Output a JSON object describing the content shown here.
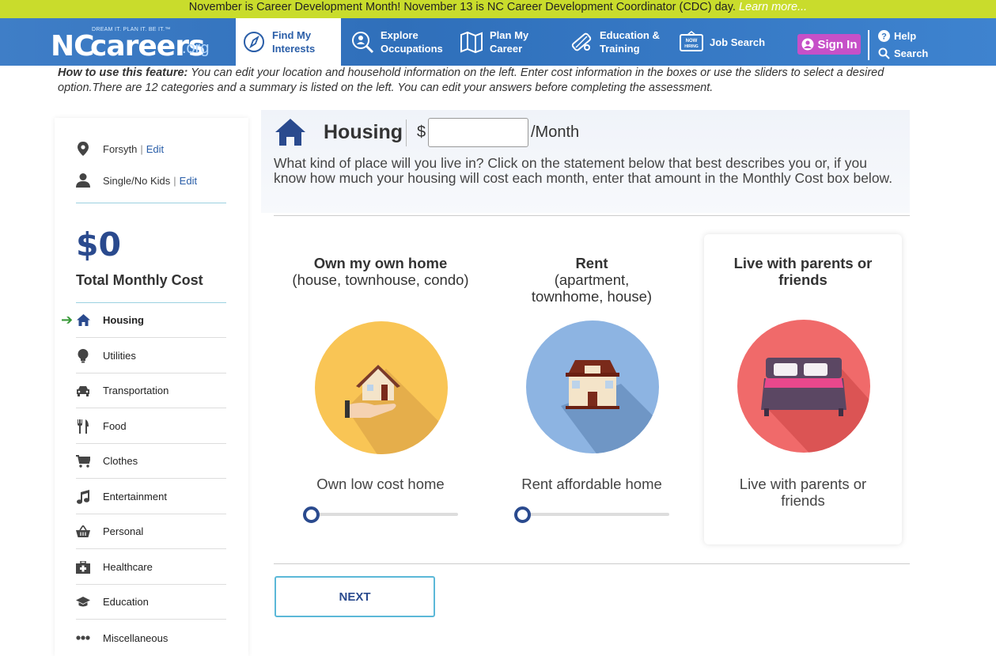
{
  "announcement": {
    "text": "November is Career Development Month! November 13 is NC Career Development Coordinator (CDC) day.",
    "link": "Learn more..."
  },
  "logo": {
    "nc": "NC",
    "careers": "careers",
    "org": ".org",
    "tagline": "DREAM IT. PLAN IT. BE IT.™"
  },
  "nav": {
    "items": [
      {
        "line1": "Find My",
        "line2": "Interests"
      },
      {
        "line1": "Explore",
        "line2": "Occupations"
      },
      {
        "line1": "Plan My",
        "line2": "Career"
      },
      {
        "line1": "Education &",
        "line2": "Training"
      },
      {
        "line1": "Job Search",
        "badge": "NOW HIRING"
      }
    ],
    "signin": "Sign In",
    "help": "Help",
    "search": "Search"
  },
  "howto": {
    "label": "How to use this feature:",
    "text": "You can edit your location and household information on the left. Enter cost information in the boxes or use the sliders to select a desired option.There are 12 categories and a summary is listed on the left. You can edit your answers before completing the assessment."
  },
  "sidebar": {
    "location": "Forsyth",
    "household": "Single/No Kids",
    "edit": "Edit",
    "total": "$0",
    "total_label": "Total Monthly Cost",
    "categories": [
      "Housing",
      "Utilities",
      "Transportation",
      "Food",
      "Clothes",
      "Entertainment",
      "Personal",
      "Healthcare",
      "Education",
      "Miscellaneous"
    ]
  },
  "main": {
    "title": "Housing",
    "dollar": "$",
    "cost_value": "",
    "per_month": "/Month",
    "question": "What kind of place will you live in? Click on the statement below that best describes you or, if you know how much your housing will cost each month, enter that amount in the Monthly Cost box below.",
    "options": [
      {
        "title": "Own my own home",
        "detail": "(house, townhouse, condo)",
        "sub": "Own low cost home",
        "slider_value": 0
      },
      {
        "title": "Rent",
        "detail": "(apartment, townhome, house)",
        "sub": "Rent affordable home",
        "slider_value": 0
      },
      {
        "title": "Live with parents or friends",
        "detail": "",
        "sub": "Live with parents or friends",
        "selected": true
      }
    ],
    "next": "NEXT"
  },
  "colors": {
    "announce_bg": "#c9dc2c",
    "nav_blue": "#3577c0",
    "signin_bg": "#c650c8",
    "accent_navy": "#2a4a8e",
    "own_circle": "#f9c555",
    "rent_circle": "#8db4e2",
    "live_circle": "#f06a6a"
  }
}
